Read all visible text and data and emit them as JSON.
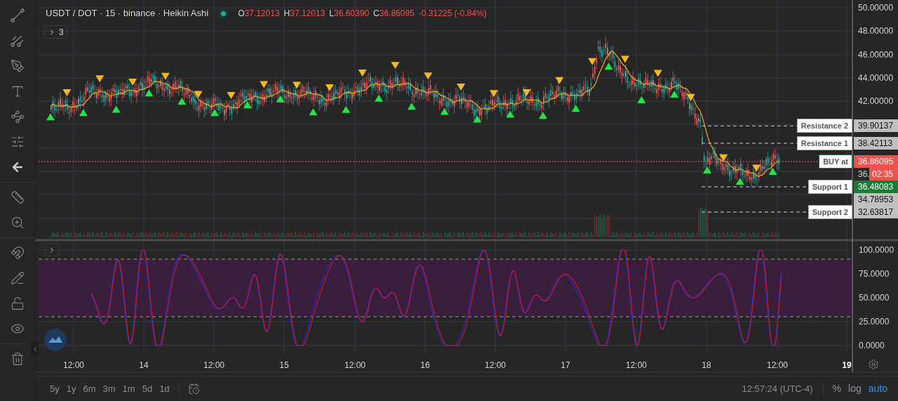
{
  "header": {
    "symbol": "USDT / DOT · 15 · binance · Heikin Ashi",
    "live": true,
    "ohlc": [
      {
        "label": "O",
        "value": "37.12013"
      },
      {
        "label": "H",
        "value": "37.12013"
      },
      {
        "label": "L",
        "value": "36.60390"
      },
      {
        "label": "C",
        "value": "36.86095"
      }
    ],
    "change": "-0.31225 (-0.84%)"
  },
  "indicators_toggle": "3",
  "price_axis": [
    "50.00000",
    "48.00000",
    "46.00000",
    "44.00000",
    "42.00000"
  ],
  "levels": [
    {
      "kind": "level",
      "label": "Resistance 2",
      "price": "39.90137",
      "color": "#c0c0c0"
    },
    {
      "kind": "level",
      "label": "Resistance 1",
      "price": "38.42113",
      "color": "#c0c0c0"
    },
    {
      "kind": "current",
      "label": "BUY at",
      "price": "36.86095",
      "color": "#ef5350",
      "countdown": "02:35"
    },
    {
      "kind": "level",
      "label": "Support 1",
      "price": "36.48083",
      "color": "#1b7a34"
    },
    {
      "kind": "plain",
      "price": "34.78953",
      "color": "#c0c0c0"
    },
    {
      "kind": "level",
      "label": "Support 2",
      "price": "32.63817",
      "color": "#c0c0c0"
    }
  ],
  "partial_axis_label": "36.",
  "oscillator_axis": [
    "100.0000",
    "75.0000",
    "50.0000",
    "25.0000",
    "0.0000"
  ],
  "time_axis": [
    {
      "label": "12:00",
      "bold": false
    },
    {
      "label": "14",
      "bold": false
    },
    {
      "label": "12:00",
      "bold": false
    },
    {
      "label": "15",
      "bold": false
    },
    {
      "label": "12:00",
      "bold": false
    },
    {
      "label": "16",
      "bold": false
    },
    {
      "label": "12:00",
      "bold": false
    },
    {
      "label": "17",
      "bold": false
    },
    {
      "label": "12:00",
      "bold": false
    },
    {
      "label": "18",
      "bold": false
    },
    {
      "label": "12:00",
      "bold": false
    },
    {
      "label": "19",
      "bold": true
    }
  ],
  "bottom_bar": {
    "ranges": [
      "5y",
      "1y",
      "6m",
      "3m",
      "1m",
      "5d",
      "1d"
    ],
    "clock": "12:57:24 (UTC-4)",
    "scale_options": [
      {
        "label": "%",
        "selected": false
      },
      {
        "label": "log",
        "selected": false
      },
      {
        "label": "auto",
        "selected": true
      }
    ]
  }
}
